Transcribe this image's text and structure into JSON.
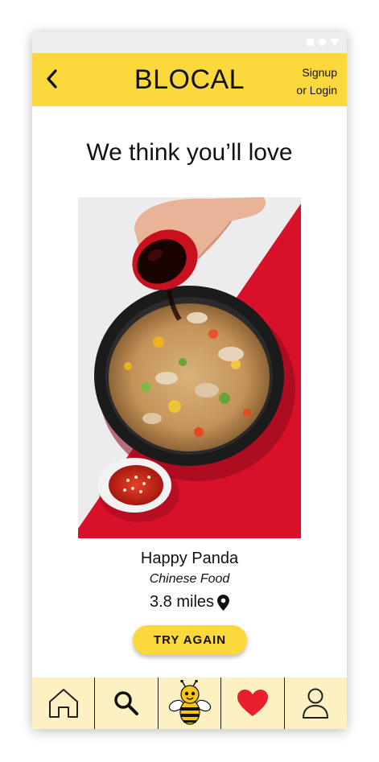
{
  "header": {
    "brand": "BLOCAL",
    "auth_line1": "Signup",
    "auth_line2": "or Login"
  },
  "main": {
    "headline": "We think you’ll love",
    "restaurant": {
      "name": "Happy Panda",
      "cuisine": "Chinese Food",
      "distance": "3.8 miles"
    },
    "try_again_label": "TRY AGAIN"
  },
  "tabs": [
    {
      "icon": "home-icon"
    },
    {
      "icon": "search-icon"
    },
    {
      "icon": "bee-icon"
    },
    {
      "icon": "heart-icon"
    },
    {
      "icon": "user-icon"
    }
  ],
  "colors": {
    "brand_yellow": "#fbd83b",
    "tabbar_bg": "#fdf1c4",
    "heart_red": "#e8202e",
    "photo_red": "#d9102a"
  }
}
